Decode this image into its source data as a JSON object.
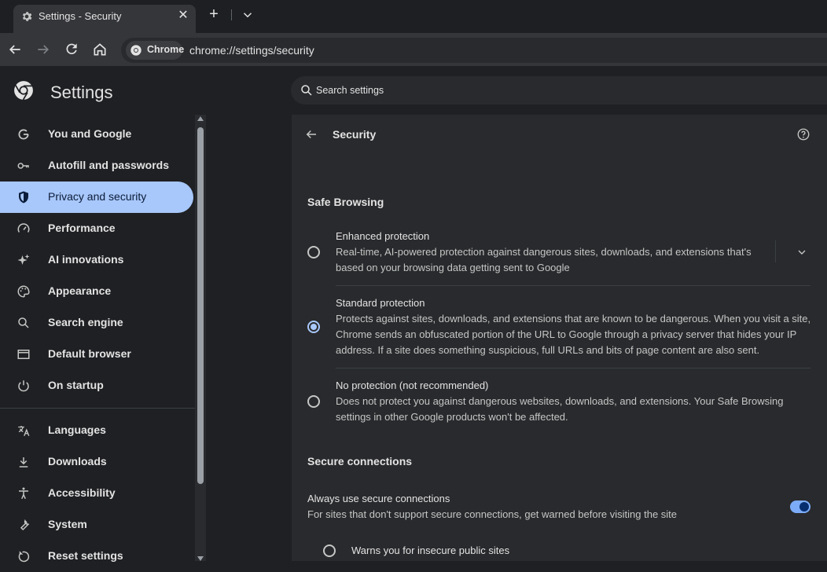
{
  "tab": {
    "title": "Settings - Security",
    "close": "✕"
  },
  "tabbar": {
    "new_tab": "+"
  },
  "omnibox": {
    "chip_label": "Chrome",
    "url": "chrome://settings/security"
  },
  "header": {
    "title": "Settings",
    "search_placeholder": "Search settings"
  },
  "sidebar": {
    "items": [
      {
        "label": "You and Google",
        "icon": "google-g-icon"
      },
      {
        "label": "Autofill and passwords",
        "icon": "key-icon"
      },
      {
        "label": "Privacy and security",
        "icon": "shield-icon",
        "active": true
      },
      {
        "label": "Performance",
        "icon": "speedometer-icon"
      },
      {
        "label": "AI innovations",
        "icon": "sparkle-icon"
      },
      {
        "label": "Appearance",
        "icon": "palette-icon"
      },
      {
        "label": "Search engine",
        "icon": "search-icon"
      },
      {
        "label": "Default browser",
        "icon": "browser-window-icon"
      },
      {
        "label": "On startup",
        "icon": "power-icon"
      },
      {
        "label": "Languages",
        "icon": "translate-icon"
      },
      {
        "label": "Downloads",
        "icon": "download-icon"
      },
      {
        "label": "Accessibility",
        "icon": "accessibility-icon"
      },
      {
        "label": "System",
        "icon": "wrench-icon"
      },
      {
        "label": "Reset settings",
        "icon": "reset-icon"
      }
    ]
  },
  "page": {
    "title": "Security",
    "safe_browsing": {
      "heading": "Safe Browsing",
      "options": [
        {
          "title": "Enhanced protection",
          "desc": [
            "Real-time, AI-powered protection against dangerous sites, downloads, and extensions that's",
            "based on your browsing data getting sent to Google"
          ],
          "selected": false
        },
        {
          "title": "Standard protection",
          "desc": [
            "Protects against sites, downloads, and extensions that are known to be dangerous. When you visit a site,",
            "Chrome sends an obfuscated portion of the URL to Google through a privacy server that hides your IP",
            "address. If a site does something suspicious, full URLs and bits of page content are also sent."
          ],
          "selected": true
        },
        {
          "title": "No protection (not recommended)",
          "desc": [
            "Does not protect you against dangerous websites, downloads, and extensions. Your Safe Browsing",
            "settings in other Google products won't be affected."
          ],
          "selected": false
        }
      ]
    },
    "secure_connections": {
      "heading": "Secure connections",
      "always_title": "Always use secure connections",
      "always_desc": "For sites that don't support secure connections, get warned before visiting the site",
      "toggle_on": true,
      "sub_option": "Warns you for insecure public sites"
    }
  },
  "colors": {
    "accent": "#a8c7fa",
    "background": "#1f2023",
    "card": "#292a2d"
  }
}
